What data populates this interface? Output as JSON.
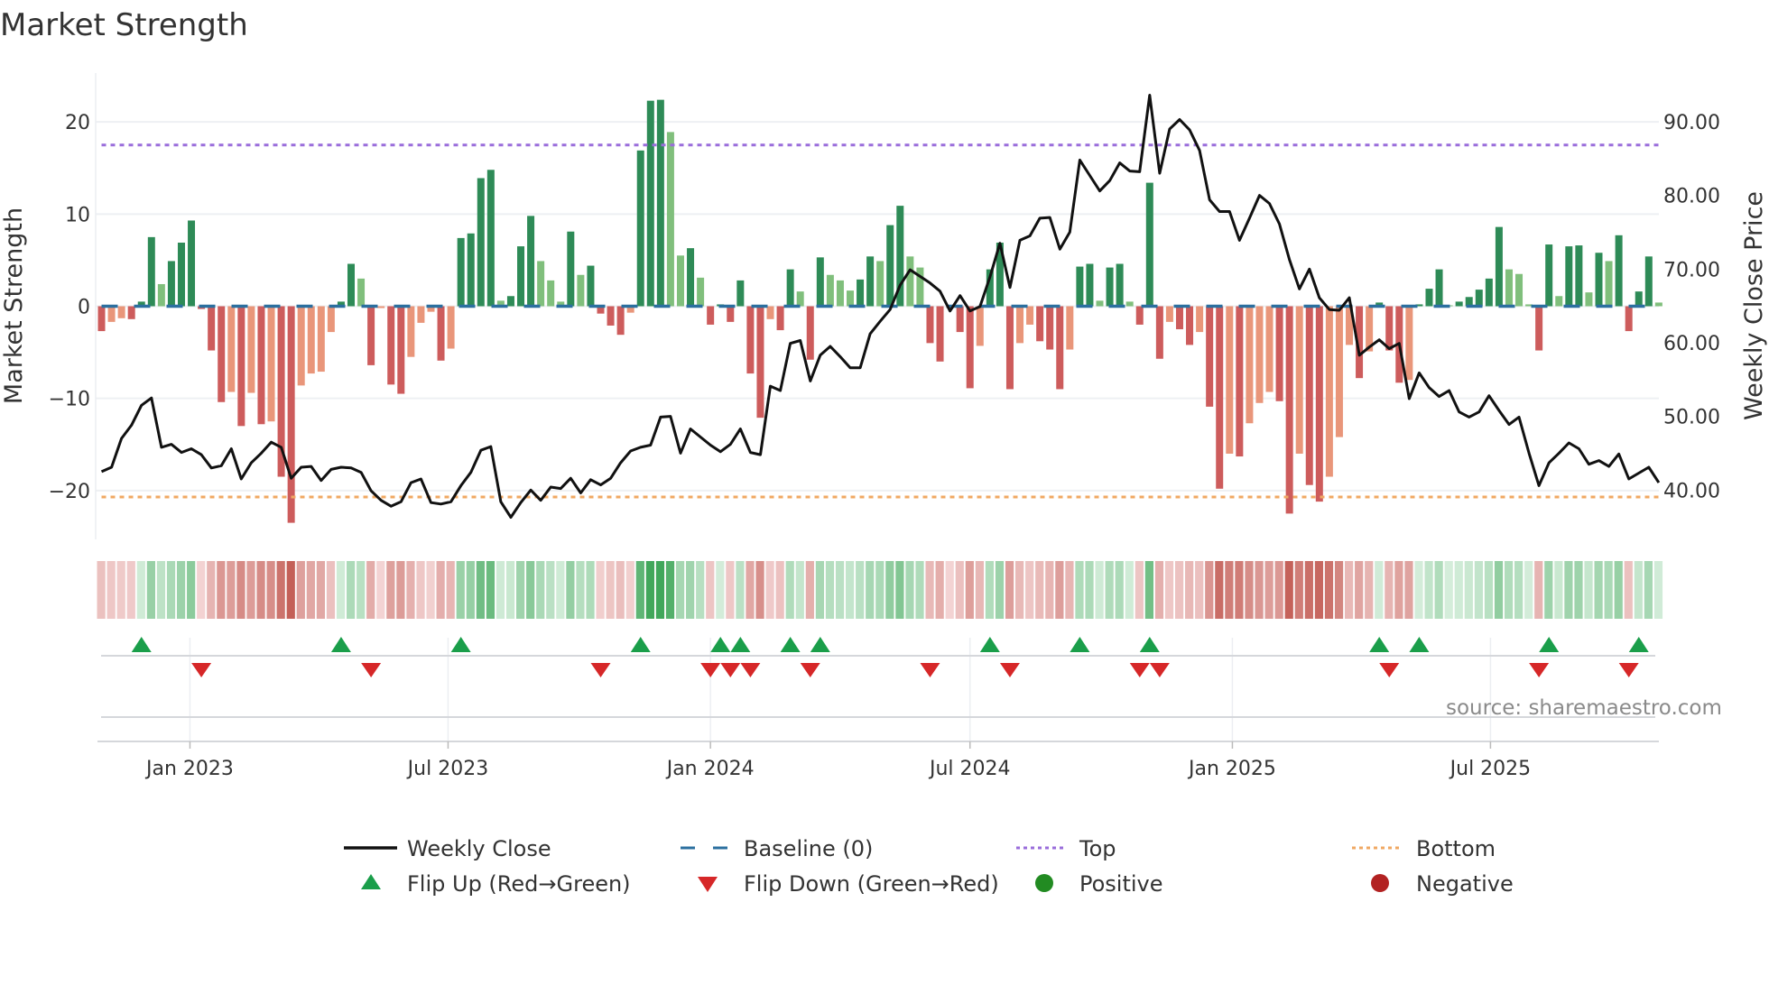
{
  "chart_data": {
    "type": "bar",
    "title": "Market Strength",
    "ylabel": "Market Strength",
    "y2label": "Weekly Close Price",
    "ylim": [
      -25.3,
      25.3
    ],
    "y2lim": [
      33.3,
      96.6
    ],
    "grid": true,
    "legend_placement": "bottom-center",
    "x_start": "2022-10-31",
    "x_step_days": 7,
    "x_ticks": [
      {
        "label": "Jan 2023",
        "date": "2023-01-01"
      },
      {
        "label": "Jul 2023",
        "date": "2023-07-01"
      },
      {
        "label": "Jan 2024",
        "date": "2024-01-01"
      },
      {
        "label": "Jul 2024",
        "date": "2024-07-01"
      },
      {
        "label": "Jan 2025",
        "date": "2025-01-01"
      },
      {
        "label": "Jul 2025",
        "date": "2025-07-01"
      }
    ],
    "y_ticks": [
      {
        "value": 20,
        "label": "20"
      },
      {
        "value": 10,
        "label": "10"
      },
      {
        "value": 0,
        "label": "0"
      },
      {
        "value": -10,
        "label": "−10"
      },
      {
        "value": -20,
        "label": "−20"
      }
    ],
    "y2_ticks": [
      {
        "value": 90,
        "label": "90.00"
      },
      {
        "value": 80,
        "label": "80.00"
      },
      {
        "value": 70,
        "label": "70.00"
      },
      {
        "value": 60,
        "label": "60.00"
      },
      {
        "value": 50,
        "label": "50.00"
      },
      {
        "value": 40,
        "label": "40.00"
      }
    ],
    "top_level": 17.5,
    "bottom_level": -20.7,
    "baseline": 0,
    "series": [
      {
        "name": "Market Strength",
        "type": "bar",
        "values": [
          -2.7,
          -1.7,
          -1.3,
          -1.4,
          0.5,
          7.5,
          2.4,
          4.9,
          6.9,
          9.3,
          -0.3,
          -4.8,
          -10.4,
          -9.3,
          -13.0,
          -9.4,
          -12.8,
          -12.5,
          -18.5,
          -23.5,
          -8.6,
          -7.3,
          -7.1,
          -2.8,
          0.5,
          4.6,
          3.0,
          -6.4,
          -0.2,
          -8.5,
          -9.5,
          -5.5,
          -1.8,
          -0.6,
          -5.9,
          -4.6,
          7.4,
          7.9,
          13.9,
          14.8,
          0.6,
          1.1,
          6.5,
          9.8,
          4.9,
          2.8,
          0.5,
          8.1,
          3.4,
          4.4,
          -0.8,
          -2.1,
          -3.1,
          -0.7,
          16.9,
          22.3,
          22.4,
          18.9,
          5.5,
          6.3,
          3.1,
          -2.0,
          0.2,
          -1.7,
          2.8,
          -7.3,
          -12.1,
          -1.4,
          -2.6,
          4.0,
          1.6,
          -5.8,
          5.3,
          3.4,
          2.8,
          1.7,
          2.9,
          5.4,
          4.9,
          8.8,
          10.9,
          5.4,
          4.2,
          -4.0,
          -6.0,
          -0.2,
          -2.8,
          -8.9,
          -4.3,
          4.0,
          6.9,
          -9.0,
          -4.0,
          -2.0,
          -3.8,
          -4.7,
          -9.0,
          -4.7,
          4.3,
          4.6,
          0.6,
          4.2,
          4.6,
          0.5,
          -2.0,
          13.4,
          -5.7,
          -1.7,
          -2.5,
          -4.2,
          -2.8,
          -10.9,
          -19.8,
          -16.0,
          -16.3,
          -12.7,
          -10.5,
          -9.3,
          -10.3,
          -22.5,
          -16.0,
          -19.4,
          -21.2,
          -18.5,
          -14.2,
          -4.2,
          -7.8,
          -4.9,
          0.4,
          -4.8,
          -8.3,
          -8.0,
          0.2,
          1.9,
          4.0,
          0.1,
          0.5,
          1.0,
          1.8,
          3.0,
          8.6,
          4.0,
          3.5,
          0.2,
          -4.8,
          6.7,
          1.1,
          6.5,
          6.6,
          1.5,
          5.8,
          4.9,
          7.7,
          -2.7,
          1.6,
          5.4,
          0.4
        ]
      },
      {
        "name": "Weekly Close",
        "type": "line",
        "axis": "right",
        "values": [
          42.5,
          43.1,
          47.0,
          48.8,
          51.5,
          52.5,
          45.8,
          46.2,
          45.1,
          45.6,
          44.8,
          43.0,
          43.3,
          45.6,
          41.5,
          43.7,
          45.0,
          46.5,
          45.8,
          41.6,
          43.1,
          43.2,
          41.3,
          42.8,
          43.1,
          43.0,
          42.4,
          39.9,
          38.6,
          37.8,
          38.4,
          41.0,
          41.5,
          38.3,
          38.1,
          38.4,
          40.6,
          42.4,
          45.4,
          45.9,
          38.4,
          36.3,
          38.3,
          40.0,
          38.6,
          40.4,
          40.2,
          41.6,
          39.6,
          41.4,
          40.7,
          41.6,
          43.7,
          45.3,
          45.8,
          46.1,
          49.9,
          50.0,
          45.0,
          48.3,
          47.2,
          46.1,
          45.2,
          46.2,
          48.3,
          45.1,
          44.8,
          54.1,
          53.5,
          59.9,
          60.3,
          54.8,
          58.3,
          59.5,
          58.1,
          56.6,
          56.6,
          61.2,
          62.9,
          64.5,
          67.8,
          69.9,
          69.0,
          68.1,
          67.0,
          64.3,
          66.4,
          64.3,
          64.9,
          68.9,
          73.5,
          67.5,
          73.9,
          74.5,
          76.9,
          77.0,
          72.7,
          75.0,
          84.8,
          82.7,
          80.6,
          82.0,
          84.4,
          83.3,
          83.2,
          93.6,
          83.0,
          89.0,
          90.3,
          88.9,
          86.1,
          79.4,
          77.8,
          77.8,
          73.9,
          76.9,
          80.0,
          78.9,
          76.1,
          71.3,
          67.3,
          70.0,
          66.1,
          64.5,
          64.4,
          66.1,
          58.3,
          59.4,
          60.4,
          59.2,
          59.9,
          52.4,
          55.9,
          53.9,
          52.7,
          53.5,
          50.6,
          49.9,
          50.6,
          52.8,
          50.8,
          48.9,
          49.9,
          45.0,
          40.6,
          43.7,
          45.0,
          46.4,
          45.6,
          43.5,
          44.0,
          43.2,
          44.9,
          41.5,
          42.3,
          43.1,
          41.0
        ]
      }
    ],
    "legend": [
      {
        "label": "Weekly Close",
        "symbol": "line"
      },
      {
        "label": "Baseline (0)",
        "symbol": "dash"
      },
      {
        "label": "Top",
        "symbol": "dot"
      },
      {
        "label": "Bottom",
        "symbol": "dot"
      },
      {
        "label": "Flip Up (Red→Green)",
        "symbol": "triangle-up"
      },
      {
        "label": "Flip Down (Green→Red)",
        "symbol": "triangle-down"
      },
      {
        "label": "Positive",
        "symbol": "circle"
      },
      {
        "label": "Negative",
        "symbol": "circle"
      }
    ],
    "source": "source: sharemaestro.com"
  },
  "colors": {
    "bar_up_strong": "#2e8b57",
    "bar_up_weak": "#80bf7c",
    "bar_down_strong": "#cd5c5c",
    "bar_down_weak": "#e9967a",
    "close_line": "#111111",
    "baseline": "#2b6f9f",
    "top": "#9a6ddb",
    "bottom": "#f0a863",
    "flip_up": "#1a9e4a",
    "flip_down": "#d62728",
    "positive": "#228b22",
    "negative": "#b22222"
  }
}
